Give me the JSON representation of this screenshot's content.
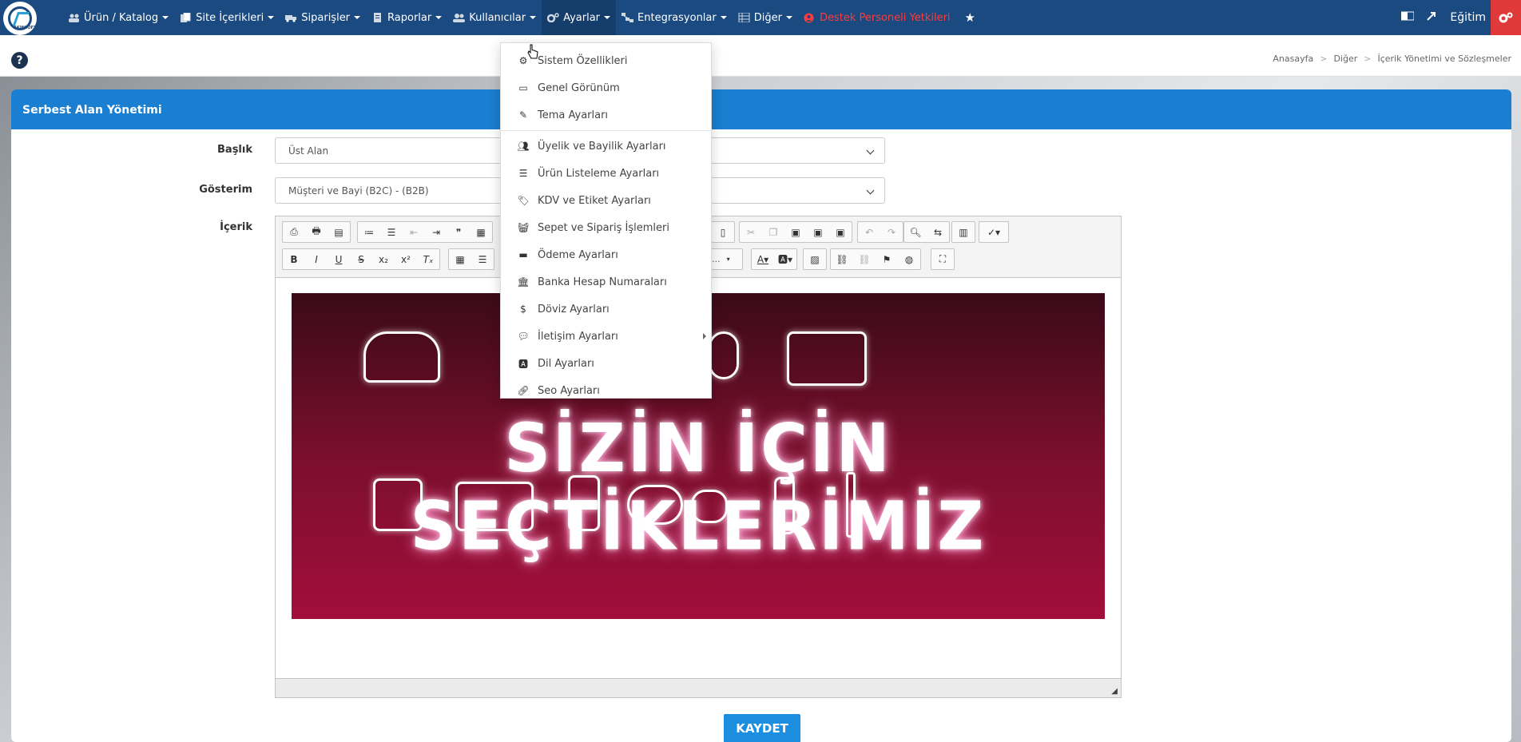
{
  "nav": {
    "items": [
      {
        "label": "Ürün / Katalog",
        "icon": "users-icon"
      },
      {
        "label": "Site İçerikleri",
        "icon": "copy-icon"
      },
      {
        "label": "Siparişler",
        "icon": "truck-icon"
      },
      {
        "label": "Raporlar",
        "icon": "report-icon"
      },
      {
        "label": "Kullanıcılar",
        "icon": "user-group-icon"
      },
      {
        "label": "Ayarlar",
        "icon": "gears-icon"
      },
      {
        "label": "Entegrasyonlar",
        "icon": "sitemap-icon"
      },
      {
        "label": "Diğer",
        "icon": "grid-icon"
      }
    ],
    "support": "Destek Personeli Yetkileri",
    "user": "Eğitim"
  },
  "breadcrumb": [
    "Anasayfa",
    "Diğer",
    "İçerik Yönetimi ve Sözleşmeler"
  ],
  "panel": {
    "title": "Serbest Alan Yönetimi",
    "baslik_label": "Başlık",
    "baslik_value": "Üst Alan",
    "gosterim_label": "Gösterim",
    "gosterim_value": "Müşteri ve Bayi (B2C) - (B2B)",
    "icerik_label": "İçerik",
    "font_dropdown": "Bo...",
    "banner_text": "SİZİN İÇİN SEÇTİKLERİMİZ",
    "save": "KAYDET"
  },
  "dropdown": {
    "items": [
      {
        "label": "Sistem Özellikleri",
        "icon": "gears-icon"
      },
      {
        "label": "Genel Görünüm",
        "icon": "monitor-icon"
      },
      {
        "label": "Tema Ayarları",
        "icon": "brush-icon"
      },
      {
        "label": "Üyelik ve Bayilik Ayarları",
        "icon": "users-icon"
      },
      {
        "label": "Ürün Listeleme Ayarları",
        "icon": "list-icon"
      },
      {
        "label": "KDV ve Etiket Ayarları",
        "icon": "tags-icon"
      },
      {
        "label": "Sepet ve Sipariş İşlemleri",
        "icon": "basket-icon"
      },
      {
        "label": "Ödeme Ayarları",
        "icon": "credit-card-icon"
      },
      {
        "label": "Banka Hesap Numaraları",
        "icon": "bank-icon"
      },
      {
        "label": "Döviz Ayarları",
        "icon": "dollar-icon"
      },
      {
        "label": "İletişim Ayarları",
        "icon": "comments-icon"
      },
      {
        "label": "Dil Ayarları",
        "icon": "language-icon"
      },
      {
        "label": "Seo Ayarları",
        "icon": "link-icon"
      }
    ]
  }
}
